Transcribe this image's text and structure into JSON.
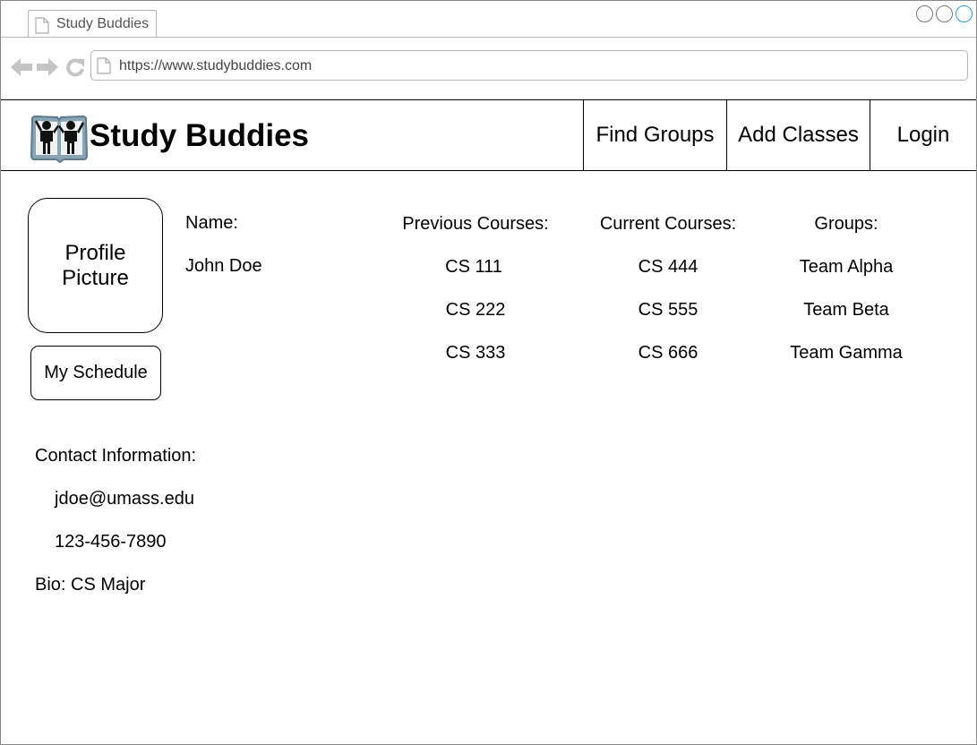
{
  "browser": {
    "tab_title": "Study Buddies",
    "url": "https://www.studybuddies.com"
  },
  "header": {
    "brand": "Study Buddies",
    "nav": [
      "Find Groups",
      "Add Classes",
      "Login"
    ]
  },
  "profile": {
    "picture_label": "Profile Picture",
    "schedule_button": "My Schedule",
    "name_label": "Name:",
    "name_value": "John Doe",
    "previous_courses": {
      "label": "Previous Courses:",
      "items": [
        "CS 111",
        "CS 222",
        "CS 333"
      ]
    },
    "current_courses": {
      "label": "Current Courses:",
      "items": [
        "CS 444",
        "CS 555",
        "CS 666"
      ]
    },
    "groups": {
      "label": "Groups:",
      "items": [
        "Team Alpha",
        "Team Beta",
        "Team Gamma"
      ]
    },
    "contact_label": "Contact Information:",
    "email": "jdoe@umass.edu",
    "phone": "123-456-7890",
    "bio": "Bio: CS Major"
  },
  "icons": {
    "logo": "study-buddies-logo-icon",
    "back": "back-arrow-icon",
    "forward": "forward-arrow-icon",
    "reload": "reload-icon",
    "page": "page-icon"
  }
}
